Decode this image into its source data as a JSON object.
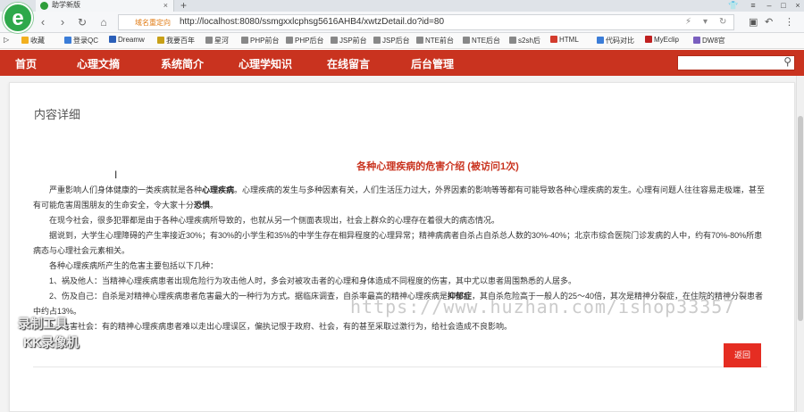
{
  "browser": {
    "tab_title": "助学新版",
    "tab_close": "×",
    "new_tab": "+",
    "secure_label": "域名重定向",
    "url": "http://localhost:8080/ssmgxxlcphsg5616AHB4/xwtzDetail.do?id=80"
  },
  "bookmarks": [
    {
      "label": "收藏",
      "color": "#f2b01e"
    },
    {
      "label": "登录QC",
      "color": "#3b7dd8"
    },
    {
      "label": "Dreamw",
      "color": "#2b5fb8"
    },
    {
      "label": "我要百年",
      "color": "#c8a017"
    },
    {
      "label": "星河",
      "color": "#888888"
    },
    {
      "label": "PHP前台",
      "color": "#888888"
    },
    {
      "label": "PHP后台",
      "color": "#888888"
    },
    {
      "label": "JSP前台",
      "color": "#888888"
    },
    {
      "label": "JSP后台",
      "color": "#888888"
    },
    {
      "label": "NTE前台",
      "color": "#888888"
    },
    {
      "label": "NTE后台",
      "color": "#888888"
    },
    {
      "label": "s2sh后",
      "color": "#888888"
    },
    {
      "label": "HTML",
      "color": "#d33b2c"
    },
    {
      "label": "代码对比",
      "color": "#3b7dd8"
    },
    {
      "label": "MyEclip",
      "color": "#c02020"
    },
    {
      "label": "DW8官",
      "color": "#7a5fbf"
    }
  ],
  "nav": {
    "items": [
      "首页",
      "心理文摘",
      "系统简介",
      "心理学知识",
      "在线留言",
      "后台管理"
    ]
  },
  "content": {
    "section_title": "内容详细",
    "article_title": "各种心理疾病的危害介绍 (被访问1次)",
    "p1_a": "严重影响人们身体健康的一类疾病就是各种",
    "p1_b": "心理疾病",
    "p1_c": "。心理疾病的发生与多种因素有关，人们生活压力过大，外界因素的影响等等都有可能导致各种心理疾病的发生。心理有问题人往往容易走极端，甚至有可能危害周围朋友的生命安全，令大家十分",
    "p1_d": "恐惧",
    "p1_e": "。",
    "p2": "在现今社会，很多犯罪都是由于各种心理疾病所导致的，也就从另一个侧面表现出，社会上群众的心理存在着很大的病态情况。",
    "p3": "据说到，大学生心理障碍的产生率接近30%；有30%的小学生和35%的中学生存在相异程度的心理异常；精神病病者自杀占自杀总人数的30%-40%；北京市综合医院门诊发病的人中，约有70%-80%所患病态与心理社会元素相关。",
    "p4": "各种心理疾病所产生的危害主要包括以下几种：",
    "p5": "1、祸及他人：当精神心理疾病患者出现危险行为攻击他人时，多会对被攻击者的心理和身体造成不同程度的伤害，其中尤以患者周围熟悉的人居多。",
    "p6_a": "2、伤及自己：自杀是对精神心理疾病患者危害最大的一种行为方式。据临床调查，自杀率最高的精神心理疾病是",
    "p6_b": "抑郁症",
    "p6_c": "，其自杀危险高于一般人的25～40倍，其次是精神分裂症，在住院的精神分裂患者中约占13%。",
    "p7": "3、危害社会：有的精神心理疾病患者难以走出心理误区，偏执记恨于政府、社会，有的甚至采取过激行为，给社会造成不良影响。",
    "back_label": "返回"
  },
  "watermarks": {
    "site": "https://www.huzhan.com/ishop33357",
    "kk_line1": "录制工具",
    "kk_line2": "KK录像机"
  },
  "colors": {
    "nav_bg": "#c9331f",
    "title_red": "#c9331f",
    "button_red": "#e52d22"
  }
}
